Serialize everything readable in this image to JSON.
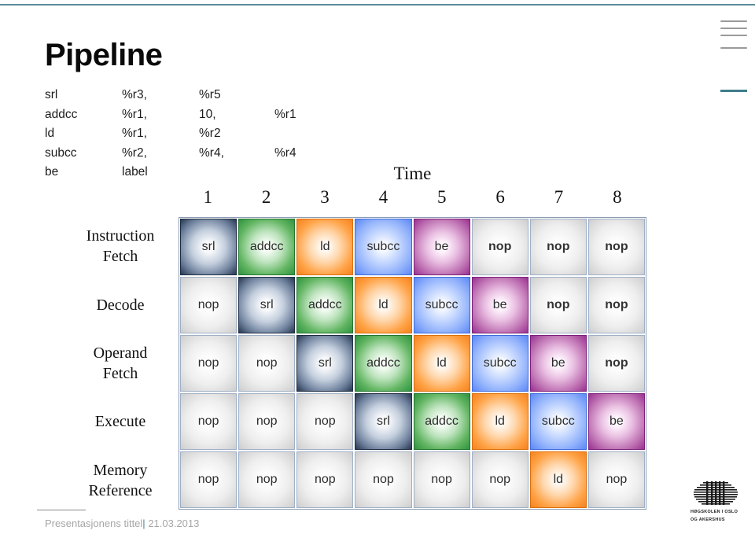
{
  "slide": {
    "title": "Pipeline",
    "accent_color": "#5b8c9b"
  },
  "code_listing": {
    "lines": [
      {
        "op": "srl",
        "a": "%r3,",
        "b": "%r5",
        "c": ""
      },
      {
        "op": "addcc",
        "a": "%r1,",
        "b": "10,",
        "c": "%r1"
      },
      {
        "op": "ld",
        "a": "%r1,",
        "b": "%r2",
        "c": ""
      },
      {
        "op": "subcc",
        "a": "%r2,",
        "b": "%r4,",
        "c": "%r4"
      },
      {
        "op": "be",
        "a": "label",
        "b": "",
        "c": ""
      }
    ]
  },
  "table": {
    "time_label": "Time",
    "columns": [
      "1",
      "2",
      "3",
      "4",
      "5",
      "6",
      "7",
      "8"
    ],
    "stages": [
      "Instruction\nFetch",
      "Decode",
      "Operand\nFetch",
      "Execute",
      "Memory\nReference"
    ],
    "stage_lines": [
      [
        "Instruction",
        "Fetch"
      ],
      [
        "Decode"
      ],
      [
        "Operand",
        "Fetch"
      ],
      [
        "Execute"
      ],
      [
        "Memory",
        "Reference"
      ]
    ],
    "rows": [
      {
        "stage": "Instruction Fetch",
        "cells": [
          {
            "label": "srl",
            "kind": "srl",
            "bold": false
          },
          {
            "label": "addcc",
            "kind": "addcc",
            "bold": false
          },
          {
            "label": "ld",
            "kind": "ld",
            "bold": false
          },
          {
            "label": "subcc",
            "kind": "subcc",
            "bold": false
          },
          {
            "label": "be",
            "kind": "be",
            "bold": false
          },
          {
            "label": "nop",
            "kind": "nop",
            "bold": true
          },
          {
            "label": "nop",
            "kind": "nop",
            "bold": true
          },
          {
            "label": "nop",
            "kind": "nop",
            "bold": true
          }
        ]
      },
      {
        "stage": "Decode",
        "cells": [
          {
            "label": "nop",
            "kind": "nop",
            "bold": false
          },
          {
            "label": "srl",
            "kind": "srl",
            "bold": false
          },
          {
            "label": "addcc",
            "kind": "addcc",
            "bold": false
          },
          {
            "label": "ld",
            "kind": "ld",
            "bold": false
          },
          {
            "label": "subcc",
            "kind": "subcc",
            "bold": false
          },
          {
            "label": "be",
            "kind": "be",
            "bold": false
          },
          {
            "label": "nop",
            "kind": "nop",
            "bold": true
          },
          {
            "label": "nop",
            "kind": "nop",
            "bold": true
          }
        ]
      },
      {
        "stage": "Operand Fetch",
        "cells": [
          {
            "label": "nop",
            "kind": "nop",
            "bold": false
          },
          {
            "label": "nop",
            "kind": "nop",
            "bold": false
          },
          {
            "label": "srl",
            "kind": "srl",
            "bold": false
          },
          {
            "label": "addcc",
            "kind": "addcc",
            "bold": false
          },
          {
            "label": "ld",
            "kind": "ld",
            "bold": false
          },
          {
            "label": "subcc",
            "kind": "subcc",
            "bold": false
          },
          {
            "label": "be",
            "kind": "be",
            "bold": false
          },
          {
            "label": "nop",
            "kind": "nop",
            "bold": true
          }
        ]
      },
      {
        "stage": "Execute",
        "cells": [
          {
            "label": "nop",
            "kind": "nop",
            "bold": false
          },
          {
            "label": "nop",
            "kind": "nop",
            "bold": false
          },
          {
            "label": "nop",
            "kind": "nop",
            "bold": false
          },
          {
            "label": "srl",
            "kind": "srl",
            "bold": false
          },
          {
            "label": "addcc",
            "kind": "addcc",
            "bold": false
          },
          {
            "label": "ld",
            "kind": "ld",
            "bold": false
          },
          {
            "label": "subcc",
            "kind": "subcc",
            "bold": false
          },
          {
            "label": "be",
            "kind": "be",
            "bold": false
          }
        ]
      },
      {
        "stage": "Memory Reference",
        "cells": [
          {
            "label": "nop",
            "kind": "nop",
            "bold": false
          },
          {
            "label": "nop",
            "kind": "nop",
            "bold": false
          },
          {
            "label": "nop",
            "kind": "nop",
            "bold": false
          },
          {
            "label": "nop",
            "kind": "nop",
            "bold": false
          },
          {
            "label": "nop",
            "kind": "nop",
            "bold": false
          },
          {
            "label": "nop",
            "kind": "nop",
            "bold": false
          },
          {
            "label": "ld",
            "kind": "ld",
            "bold": false
          },
          {
            "label": "nop",
            "kind": "nop",
            "bold": false
          }
        ]
      }
    ],
    "colors": {
      "srl": "#28374f",
      "addcc": "#2f9340",
      "ld": "#f5821f",
      "subcc": "#5c88f5",
      "be": "#993090",
      "nop": "#cccccc"
    }
  },
  "footer": {
    "title": "Presentasjonens tittel",
    "separator": "|",
    "date": "21.03.2013"
  },
  "logo": {
    "line1": "HØGSKOLEN I OSLO",
    "line2": "OG AKERSHUS"
  }
}
